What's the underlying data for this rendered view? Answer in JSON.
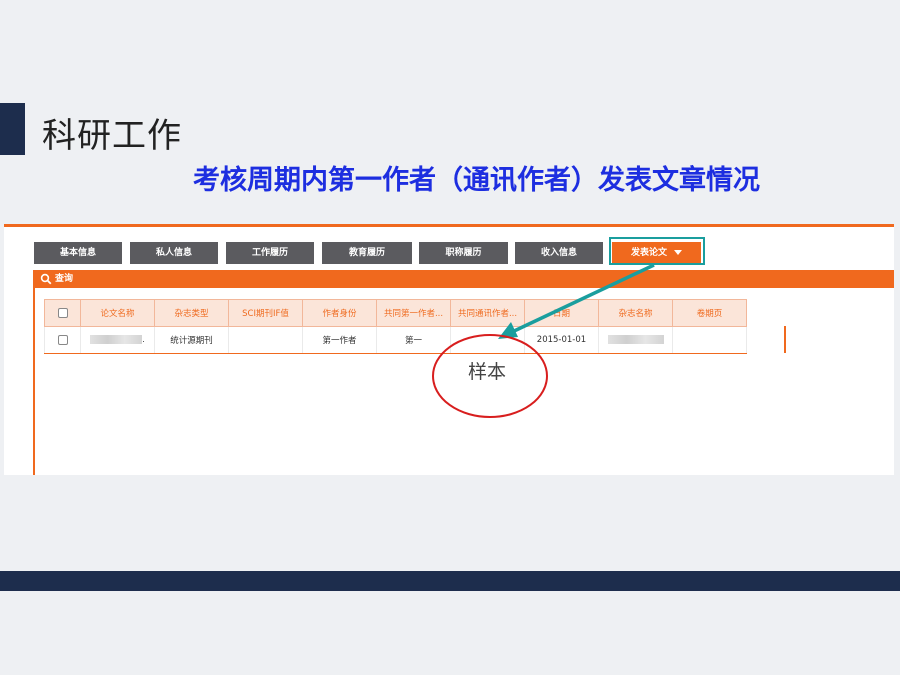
{
  "slide": {
    "title": "科研工作",
    "subtitle": "考核周期内第一作者（通讯作者）发表文章情况",
    "annotation_label": "样本",
    "colors": {
      "navy": "#1d2d4d",
      "orange": "#f0691e",
      "subtitle_blue": "#1d2ee0",
      "callout_teal": "#1a9e9e",
      "circle_red": "#d81e1e"
    }
  },
  "app": {
    "tabs": [
      {
        "label": "基本信息"
      },
      {
        "label": "私人信息"
      },
      {
        "label": "工作履历"
      },
      {
        "label": "教育履历"
      },
      {
        "label": "职称履历"
      },
      {
        "label": "收入信息"
      },
      {
        "label": "发表论文",
        "active": true,
        "icon": "chevron-down-icon"
      }
    ],
    "query_label": "查询",
    "table": {
      "headers": [
        "论文名称",
        "杂志类型",
        "SCI期刊IF值",
        "作者身份",
        "共同第一作者...",
        "共同通讯作者...",
        "日期",
        "杂志名称",
        "卷期页"
      ],
      "rows": [
        {
          "paper_name": "(blurred)",
          "journal_type": "统计源期刊",
          "sci_if": "",
          "author_role": "第一作者",
          "co_first": "第一",
          "co_corresponding": "",
          "date": "2015-01-01",
          "journal_name": "(blurred)",
          "volume": ""
        }
      ]
    }
  }
}
